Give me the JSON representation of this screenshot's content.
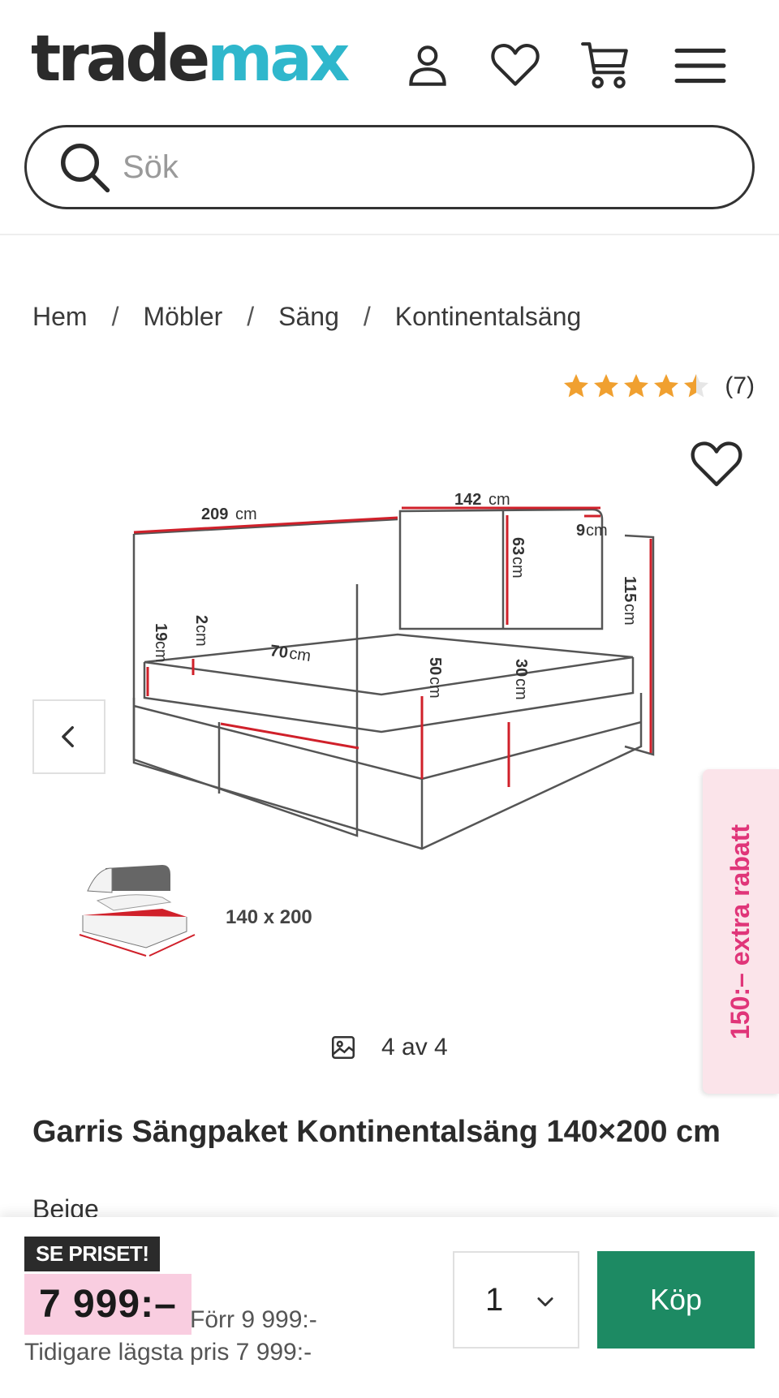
{
  "header": {
    "logo_part1": "trade",
    "logo_part2": "max",
    "icons": [
      "user-icon",
      "heart-icon",
      "cart-icon",
      "menu-icon"
    ],
    "search_placeholder": "Sök"
  },
  "breadcrumb": {
    "items": [
      "Hem",
      "Möbler",
      "Säng",
      "Kontinentalsäng"
    ],
    "separator": "/"
  },
  "rating": {
    "stars": 4.5,
    "count_label": "(7)"
  },
  "gallery": {
    "counter": "4 av 4",
    "dimensions": {
      "length": "209",
      "width": "142",
      "headboard_height": "63",
      "headboard_depth": "9",
      "total_height": "115",
      "mattress_top": "2",
      "mattress_side": "19",
      "box_depth": "70",
      "bed_height": "50",
      "base_height": "30",
      "unit": "cm"
    },
    "size_label": "140 x 200"
  },
  "promo_tab": "150:– extra rabatt",
  "product": {
    "title": "Garris Sängpaket Kontinentalsäng 140×200 cm",
    "color": "Beige"
  },
  "purchase": {
    "badge": "SE PRISET!",
    "price": "7 999:–",
    "was_price": "Förr 9 999:-",
    "lowest_price": "Tidigare lägsta pris 7 999:-",
    "quantity": "1",
    "buy_label": "Köp"
  },
  "colors": {
    "brand_teal": "#2fb7cc",
    "buy_green": "#1d8a63",
    "price_pink": "#f9cde0",
    "promo_pink": "#e03579",
    "star_orange": "#f0a030"
  }
}
